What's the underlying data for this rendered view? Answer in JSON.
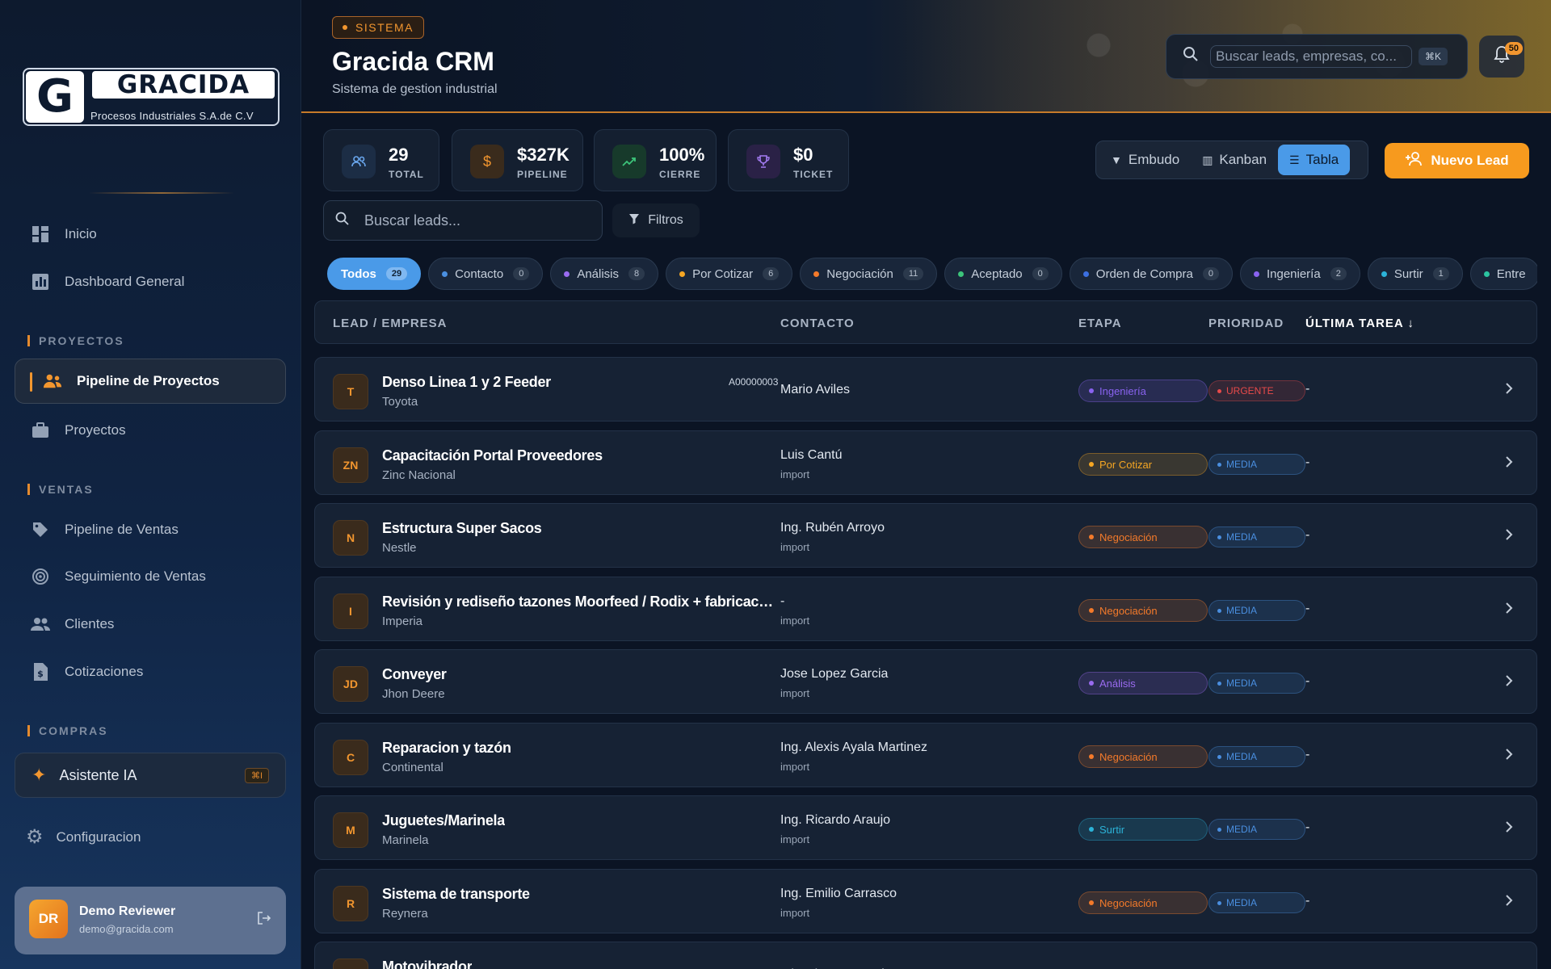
{
  "sidebar": {
    "logo_letter": "G",
    "logo_name": "GRACIDA",
    "logo_sub": "Procesos Industriales S.A.de C.V",
    "nav_top": [
      {
        "label": "Inicio",
        "icon": "dashboard-grid-icon"
      },
      {
        "label": "Dashboard General",
        "icon": "chart-icon"
      }
    ],
    "section_proyectos": "PROYECTOS",
    "proyectos": [
      {
        "label": "Pipeline de Proyectos",
        "icon": "team-icon",
        "active": true
      },
      {
        "label": "Proyectos",
        "icon": "briefcase-icon"
      }
    ],
    "section_ventas": "VENTAS",
    "ventas": [
      {
        "label": "Pipeline de Ventas",
        "icon": "tag-icon"
      },
      {
        "label": "Seguimiento de Ventas",
        "icon": "radar-icon"
      },
      {
        "label": "Clientes",
        "icon": "people-icon"
      },
      {
        "label": "Cotizaciones",
        "icon": "invoice-icon"
      }
    ],
    "section_compras": "COMPRAS",
    "ai_label": "Asistente IA",
    "ai_shortcut": "⌘I",
    "config_label": "Configuracion",
    "user": {
      "initials": "DR",
      "name": "Demo Reviewer",
      "email": "demo@gracida.com"
    }
  },
  "header": {
    "badge": "SISTEMA",
    "title": "Gracida CRM",
    "subtitle": "Sistema de gestion industrial",
    "search_placeholder": "Buscar leads, empresas, co...",
    "search_shortcut": "⌘K",
    "notifications": "50"
  },
  "stats": [
    {
      "value": "29",
      "label": "TOTAL",
      "icon": "users-icon",
      "color": "#4a8fe0"
    },
    {
      "value": "$327K",
      "label": "PIPELINE",
      "icon": "dollar-icon",
      "color": "#f2962f"
    },
    {
      "value": "100%",
      "label": "CIERRE",
      "icon": "trend-up-icon",
      "color": "#3cc47a"
    },
    {
      "value": "$0",
      "label": "TICKET",
      "icon": "trophy-icon",
      "color": "#9a6bf0"
    }
  ],
  "views": {
    "embudo": "Embudo",
    "kanban": "Kanban",
    "tabla": "Tabla",
    "active": "Tabla"
  },
  "new_lead_label": "Nuevo Lead",
  "lead_search_placeholder": "Buscar leads...",
  "filters_label": "Filtros",
  "stages": [
    {
      "label": "Todos",
      "count": "29",
      "active": true,
      "color": ""
    },
    {
      "label": "Contacto",
      "count": "0",
      "color": "#4a8fe0"
    },
    {
      "label": "Análisis",
      "count": "8",
      "color": "#9a6bf0"
    },
    {
      "label": "Por Cotizar",
      "count": "6",
      "color": "#f5a623"
    },
    {
      "label": "Negociación",
      "count": "11",
      "color": "#f47a2a"
    },
    {
      "label": "Aceptado",
      "count": "0",
      "color": "#3cc47a"
    },
    {
      "label": "Orden de Compra",
      "count": "0",
      "color": "#3c6fe0"
    },
    {
      "label": "Ingeniería",
      "count": "2",
      "color": "#8a63f0"
    },
    {
      "label": "Surtir",
      "count": "1",
      "color": "#2cb3d8"
    },
    {
      "label": "Entre",
      "count": "",
      "color": "#2bc4a0"
    }
  ],
  "table": {
    "columns": [
      "LEAD / EMPRESA",
      "CONTACTO",
      "ETAPA",
      "PRIORIDAD",
      "ÚLTIMA TAREA ↓"
    ],
    "rows": [
      {
        "initials": "T",
        "name": "Denso Linea 1 y 2 Feeder",
        "company": "Toyota",
        "code": "A00000003",
        "contact": "Mario Aviles",
        "source": "",
        "stage": "Ingeniería",
        "stage_color": "#8a63f0",
        "priority": "URGENTE",
        "priority_color": "#e84a4a",
        "task": "-"
      },
      {
        "initials": "ZN",
        "name": "Capacitación Portal Proveedores",
        "company": "Zinc Nacional",
        "code": "",
        "contact": "Luis Cantú",
        "source": "import",
        "stage": "Por Cotizar",
        "stage_color": "#f5a623",
        "priority": "MEDIA",
        "priority_color": "#4a8fe0",
        "task": "-"
      },
      {
        "initials": "N",
        "name": "Estructura Super Sacos",
        "company": "Nestle",
        "code": "",
        "contact": "Ing. Rubén Arroyo",
        "source": "import",
        "stage": "Negociación",
        "stage_color": "#f47a2a",
        "priority": "MEDIA",
        "priority_color": "#4a8fe0",
        "task": "-"
      },
      {
        "initials": "I",
        "name": "Revisión y rediseño tazones Moorfeed / Rodix + fabricación salid...",
        "company": "Imperia",
        "code": "",
        "contact": "-",
        "source": "import",
        "stage": "Negociación",
        "stage_color": "#f47a2a",
        "priority": "MEDIA",
        "priority_color": "#4a8fe0",
        "task": "-"
      },
      {
        "initials": "JD",
        "name": "Conveyer",
        "company": "Jhon Deere",
        "code": "",
        "contact": "Jose Lopez Garcia",
        "source": "import",
        "stage": "Análisis",
        "stage_color": "#9a6bf0",
        "priority": "MEDIA",
        "priority_color": "#4a8fe0",
        "task": "-"
      },
      {
        "initials": "C",
        "name": "Reparacion y tazón",
        "company": "Continental",
        "code": "",
        "contact": "Ing. Alexis Ayala Martinez",
        "source": "import",
        "stage": "Negociación",
        "stage_color": "#f47a2a",
        "priority": "MEDIA",
        "priority_color": "#4a8fe0",
        "task": "-"
      },
      {
        "initials": "M",
        "name": "Juguetes/Marinela",
        "company": "Marinela",
        "code": "",
        "contact": "Ing. Ricardo Araujo",
        "source": "import",
        "stage": "Surtir",
        "stage_color": "#2cb3d8",
        "priority": "MEDIA",
        "priority_color": "#4a8fe0",
        "task": "-"
      },
      {
        "initials": "R",
        "name": "Sistema de transporte",
        "company": "Reynera",
        "code": "",
        "contact": "Ing. Emilio Carrasco",
        "source": "import",
        "stage": "Negociación",
        "stage_color": "#f47a2a",
        "priority": "MEDIA",
        "priority_color": "#4a8fe0",
        "task": "-"
      },
      {
        "initials": "",
        "name": "Motovibrador",
        "company": "",
        "code": "",
        "contact": "Misael Serrano Díaz",
        "source": "",
        "stage": "",
        "stage_color": "#f47a2a",
        "priority": "",
        "priority_color": "#4a8fe0",
        "task": ""
      }
    ]
  }
}
